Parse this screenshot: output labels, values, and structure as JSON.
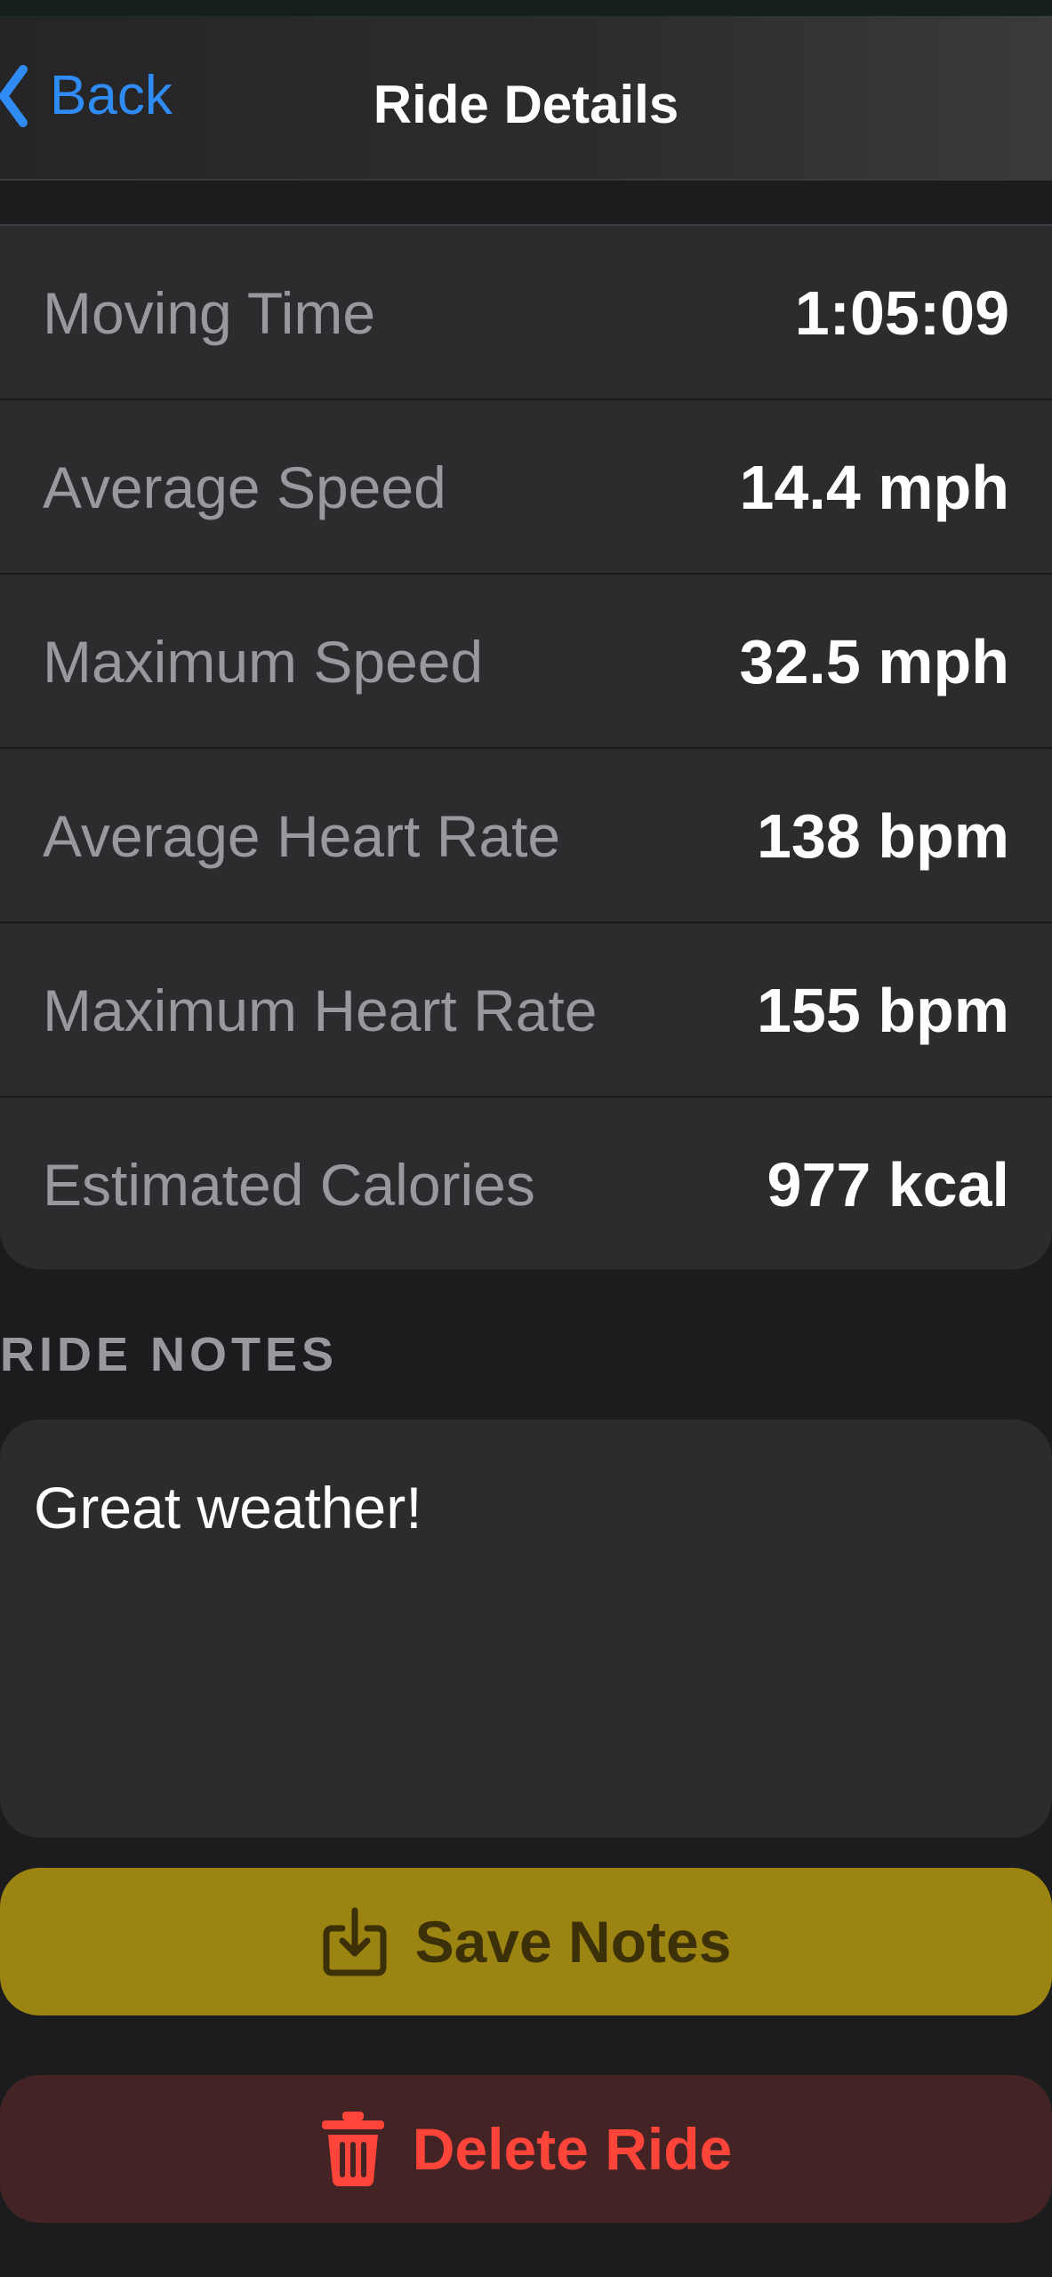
{
  "colors": {
    "background": "#1c1c1e",
    "card": "#2c2c2e",
    "accent_blue": "#2f8cf5",
    "label_gray": "#98989f",
    "save_button": "#9c8412",
    "delete_button": "#442325",
    "delete_text": "#ff453a"
  },
  "nav": {
    "back_label": "Back",
    "back_icon": "chevron-left-icon",
    "title": "Ride Details"
  },
  "stats": [
    {
      "label": "Moving Time",
      "value": "1:05:09"
    },
    {
      "label": "Average Speed",
      "value": "14.4 mph"
    },
    {
      "label": "Maximum Speed",
      "value": "32.5 mph"
    },
    {
      "label": "Average Heart Rate",
      "value": "138 bpm"
    },
    {
      "label": "Maximum Heart Rate",
      "value": "155 bpm"
    },
    {
      "label": "Estimated Calories",
      "value": "977 kcal"
    }
  ],
  "notes": {
    "section_title": "RIDE NOTES",
    "text": "Great weather!"
  },
  "actions": {
    "save_label": "Save Notes",
    "save_icon": "square-arrow-down-icon",
    "delete_label": "Delete Ride",
    "delete_icon": "trash-icon"
  }
}
